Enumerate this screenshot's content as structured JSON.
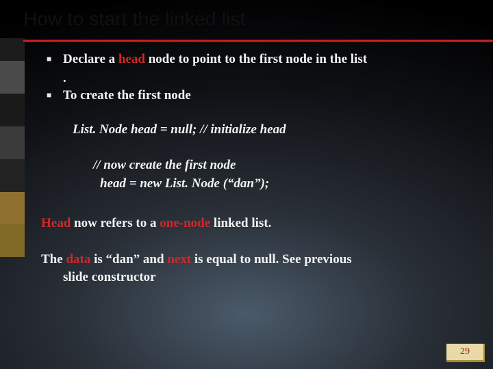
{
  "title": "How to start the linked list",
  "bullets": {
    "b1_pre": "Declare  a ",
    "b1_kw": "head ",
    "b1_post": "node  to point to the first node in the list",
    "b1_period": ".",
    "b2": "To create the first node"
  },
  "code": {
    "l1": "List. Node head = null; // initialize head",
    "l2": "// now create the first node",
    "l3": "head = new List. Node (“dan”);"
  },
  "para1": {
    "kw1": "Head ",
    "mid1": "now refers to a",
    "kw2": " one-node  ",
    "post": "linked list."
  },
  "para2": {
    "pre": "The ",
    "kw1": "data ",
    "mid1": "is  “dan”  and",
    "kw2": " next ",
    "post1": "is equal to null. See previous",
    "post2": "slide constructor"
  },
  "pagenum": "29"
}
